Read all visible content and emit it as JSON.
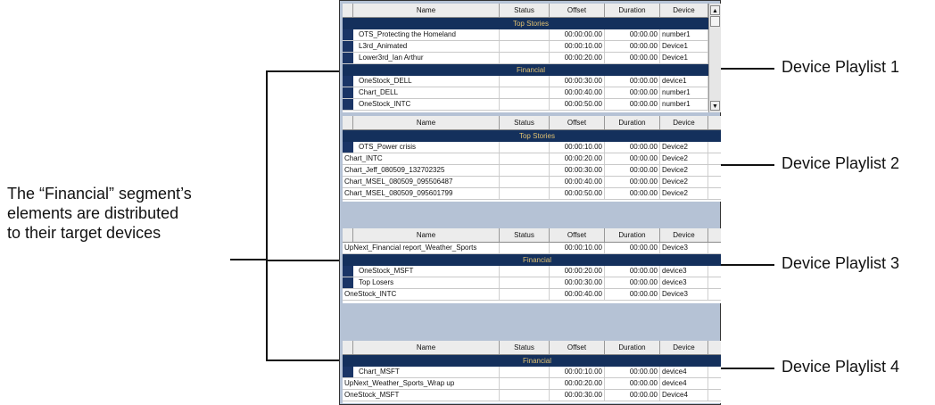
{
  "annotation": {
    "lines": [
      "The “Financial” segment’s",
      "elements are distributed",
      "to their target devices"
    ]
  },
  "labels": [
    "Device Playlist 1",
    "Device Playlist 2",
    "Device Playlist 3",
    "Device Playlist 4"
  ],
  "columns": [
    "Name",
    "Status",
    "Offset",
    "Duration",
    "Device"
  ],
  "playlists": [
    {
      "rows": [
        {
          "kind": "segment",
          "title": "Top Stories"
        },
        {
          "kind": "item",
          "marker": true,
          "name": "OTS_Protecting the Homeland",
          "status": "",
          "offset": "00:00:00.00",
          "duration": "00:00.00",
          "device": "number1"
        },
        {
          "kind": "item",
          "marker": true,
          "name": "L3rd_Animated",
          "status": "",
          "offset": "00:00:10.00",
          "duration": "00:00.00",
          "device": "Device1"
        },
        {
          "kind": "item",
          "marker": true,
          "name": "Lower3rd_Ian Arthur",
          "status": "",
          "offset": "00:00:20.00",
          "duration": "00:00.00",
          "device": "Device1"
        },
        {
          "kind": "segment",
          "title": "Financial"
        },
        {
          "kind": "item",
          "marker": true,
          "name": "OneStock_DELL",
          "status": "",
          "offset": "00:00:30.00",
          "duration": "00:00.00",
          "device": "device1"
        },
        {
          "kind": "item",
          "marker": true,
          "name": "Chart_DELL",
          "status": "",
          "offset": "00:00:40.00",
          "duration": "00:00.00",
          "device": "number1"
        },
        {
          "kind": "item",
          "marker": true,
          "name": "OneStock_INTC",
          "status": "",
          "offset": "00:00:50.00",
          "duration": "00:00.00",
          "device": "number1"
        }
      ]
    },
    {
      "rows": [
        {
          "kind": "segment",
          "title": "Top Stories"
        },
        {
          "kind": "item",
          "marker": true,
          "name": "OTS_Power crisis",
          "status": "",
          "offset": "00:00:10.00",
          "duration": "00:00.00",
          "device": "Device2"
        },
        {
          "kind": "item",
          "marker": false,
          "name": "Chart_INTC",
          "status": "",
          "offset": "00:00:20.00",
          "duration": "00:00.00",
          "device": "Device2"
        },
        {
          "kind": "item",
          "marker": false,
          "name": "Chart_Jeff_080509_132702325",
          "status": "",
          "offset": "00:00:30.00",
          "duration": "00:00.00",
          "device": "Device2"
        },
        {
          "kind": "item",
          "marker": false,
          "name": "Chart_MSEL_080509_095506487",
          "status": "",
          "offset": "00:00:40.00",
          "duration": "00:00.00",
          "device": "Device2"
        },
        {
          "kind": "item",
          "marker": false,
          "name": "Chart_MSEL_080509_095601799",
          "status": "",
          "offset": "00:00:50.00",
          "duration": "00:00.00",
          "device": "Device2"
        }
      ]
    },
    {
      "rows": [
        {
          "kind": "item",
          "marker": false,
          "name": "UpNext_Financial report_Weather_Sports",
          "status": "",
          "offset": "00:00:10.00",
          "duration": "00:00.00",
          "device": "Device3"
        },
        {
          "kind": "segment",
          "title": "Financial"
        },
        {
          "kind": "item",
          "marker": true,
          "name": "OneStock_MSFT",
          "status": "",
          "offset": "00:00:20.00",
          "duration": "00:00.00",
          "device": "device3"
        },
        {
          "kind": "item",
          "marker": true,
          "name": "Top Losers",
          "status": "",
          "offset": "00:00:30.00",
          "duration": "00:00.00",
          "device": "device3"
        },
        {
          "kind": "item",
          "marker": false,
          "name": "OneStock_INTC",
          "status": "",
          "offset": "00:00:40.00",
          "duration": "00:00.00",
          "device": "Device3"
        }
      ]
    },
    {
      "rows": [
        {
          "kind": "segment",
          "title": "Financial"
        },
        {
          "kind": "item",
          "marker": true,
          "name": "Chart_MSFT",
          "status": "",
          "offset": "00:00:10.00",
          "duration": "00:00.00",
          "device": "device4"
        },
        {
          "kind": "item",
          "marker": false,
          "name": "UpNext_Weather_Sports_Wrap up",
          "status": "",
          "offset": "00:00:20.00",
          "duration": "00:00.00",
          "device": "device4"
        },
        {
          "kind": "item",
          "marker": false,
          "name": "OneStock_MSFT",
          "status": "",
          "offset": "00:00:30.00",
          "duration": "00:00.00",
          "device": "Device4"
        }
      ]
    }
  ],
  "colors": {
    "segment_bg": "#14305c",
    "segment_text": "#e0c070",
    "marker": "#1a3566",
    "frame_bg": "#b5c2d5"
  },
  "icons": {
    "scroll_up": "up-arrow-icon",
    "scroll_down": "down-arrow-icon"
  }
}
